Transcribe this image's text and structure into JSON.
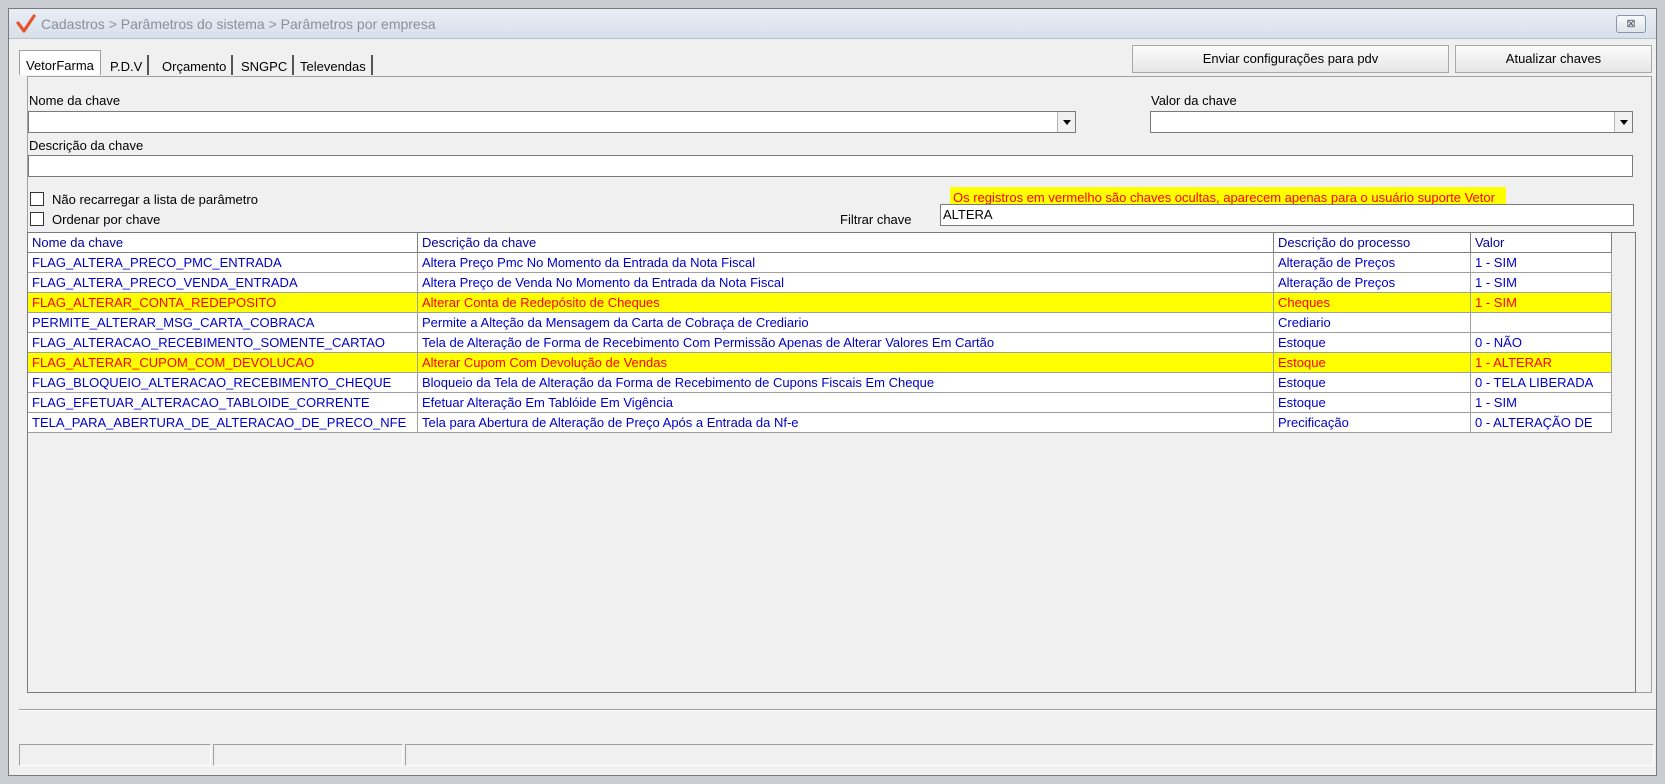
{
  "window": {
    "title": "Cadastros > Parâmetros do sistema > Parâmetros por empresa",
    "close_label": "⊠"
  },
  "tabs": [
    {
      "label": "VetorFarma"
    },
    {
      "label": "P.D.V"
    },
    {
      "label": "Orçamento"
    },
    {
      "label": "SNGPC"
    },
    {
      "label": "Televendas"
    }
  ],
  "toolbar": {
    "send_config_label": "Enviar configurações para  pdv",
    "update_keys_label": "Atualizar chaves"
  },
  "form": {
    "key_name_label": "Nome da chave",
    "key_name_value": "",
    "key_value_label": "Valor da chave",
    "key_value_value": "",
    "key_desc_label": "Descrição da chave",
    "key_desc_value": "",
    "no_reload_label": "Não recarregar a lista de parâmetro",
    "order_by_key_label": "Ordenar por chave",
    "filter_label": "Filtrar chave",
    "filter_value": "ALTERA",
    "warning_text": "Os registros em vermelho são chaves ocultas, aparecem apenas para o usuário suporte Vetor"
  },
  "grid": {
    "columns": [
      "Nome da chave",
      "Descrição  da chave",
      "Descrição do processo",
      "Valor"
    ],
    "rows": [
      {
        "name": "FLAG_ALTERA_PRECO_PMC_ENTRADA",
        "desc": "Altera Preço Pmc No Momento da Entrada da Nota Fiscal",
        "process": "Alteração de Preços",
        "value": "1 - SIM",
        "hidden": false
      },
      {
        "name": "FLAG_ALTERA_PRECO_VENDA_ENTRADA",
        "desc": "Altera Preço de Venda No Momento da Entrada da Nota Fiscal",
        "process": "Alteração de Preços",
        "value": "1 - SIM",
        "hidden": false
      },
      {
        "name": "FLAG_ALTERAR_CONTA_REDEPOSITO",
        "desc": "Alterar Conta de Redepósito de Cheques",
        "process": "Cheques",
        "value": "1 - SIM",
        "hidden": true
      },
      {
        "name": "PERMITE_ALTERAR_MSG_CARTA_COBRACA",
        "desc": "Permite a Alteção da Mensagem da Carta de Cobraça de Crediario",
        "process": "Crediario",
        "value": "",
        "hidden": false
      },
      {
        "name": "FLAG_ALTERACAO_RECEBIMENTO_SOMENTE_CARTAO",
        "desc": "Tela de Alteração de Forma de Recebimento Com Permissão Apenas de Alterar Valores Em Cartão",
        "process": "Estoque",
        "value": "0 - NÃO",
        "hidden": false
      },
      {
        "name": "FLAG_ALTERAR_CUPOM_COM_DEVOLUCAO",
        "desc": "Alterar Cupom Com Devolução de Vendas",
        "process": "Estoque",
        "value": "1 - ALTERAR",
        "hidden": true
      },
      {
        "name": "FLAG_BLOQUEIO_ALTERACAO_RECEBIMENTO_CHEQUE",
        "desc": "Bloqueio da Tela de Alteração da Forma de Recebimento de Cupons Fiscais Em Cheque",
        "process": "Estoque",
        "value": "0 - TELA LIBERADA",
        "hidden": false
      },
      {
        "name": "FLAG_EFETUAR_ALTERACAO_TABLOIDE_CORRENTE",
        "desc": "Efetuar Alteração Em Tablóide Em Vigência",
        "process": "Estoque",
        "value": "1 - SIM",
        "hidden": false
      },
      {
        "name": "TELA_PARA_ABERTURA_DE_ALTERACAO_DE_PRECO_NFE",
        "desc": "Tela para Abertura de Alteração de Preço Após a Entrada da Nf-e",
        "process": "Precificação",
        "value": "0 - ALTERAÇÃO DE",
        "hidden": false
      }
    ]
  },
  "colors": {
    "hidden_row_bg": "#ffff00",
    "hidden_row_text": "#ff0000",
    "normal_row_text": "#0000c8"
  }
}
